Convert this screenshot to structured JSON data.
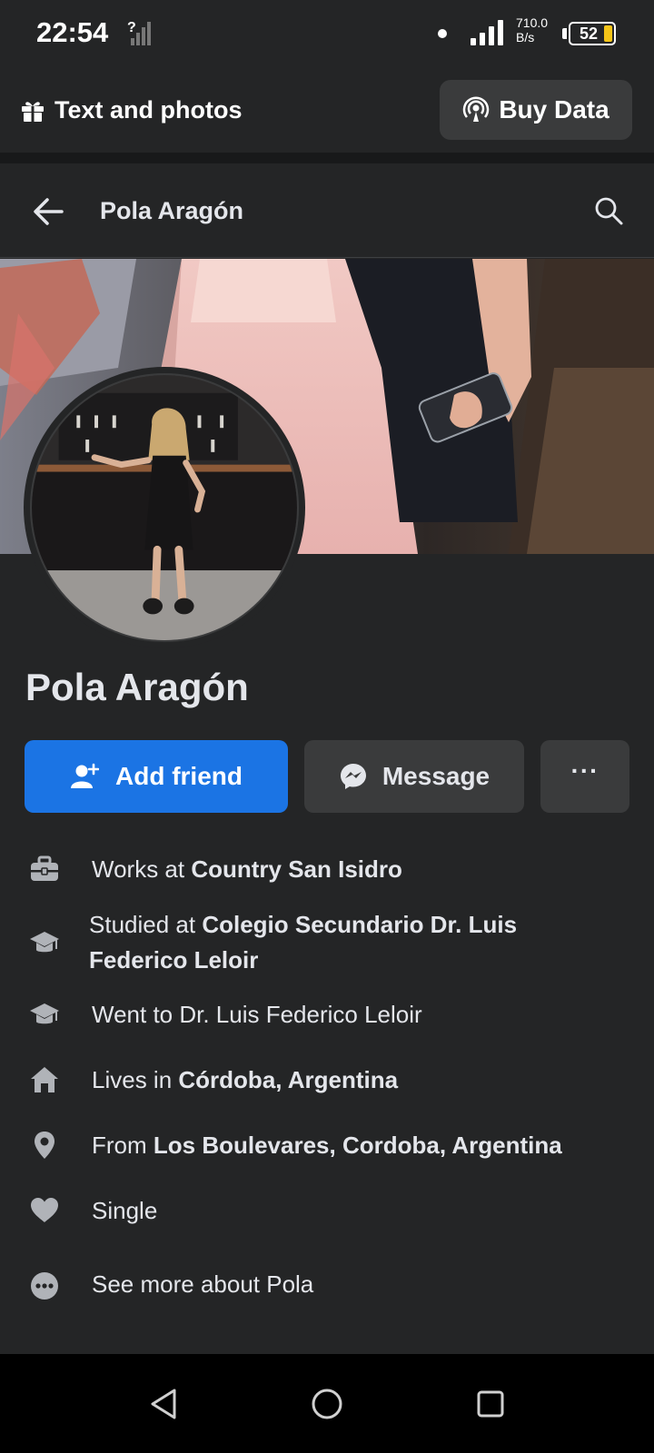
{
  "status": {
    "time": "22:54",
    "net_speed_value": "710.0",
    "net_speed_unit": "B/s",
    "battery_level": "52"
  },
  "promo": {
    "text_and_photos_label": "Text and photos",
    "buy_data_label": "Buy Data"
  },
  "nav": {
    "title": "Pola Aragón"
  },
  "profile": {
    "name": "Pola Aragón",
    "add_friend_label": "Add friend",
    "message_label": "Message",
    "more_label": "···"
  },
  "details": {
    "work_prefix": "Works at ",
    "work_value": "Country San Isidro",
    "study_prefix": "Studied at ",
    "study_value": "Colegio Secundario Dr. Luis Federico Leloir",
    "went_text": "Went to Dr. Luis Federico Leloir",
    "lives_prefix": "Lives in ",
    "lives_value": "Córdoba, Argentina",
    "from_prefix": "From ",
    "from_value": "Los Boulevares, Cordoba, Argentina",
    "relationship": "Single",
    "see_more": "See more about Pola"
  },
  "colors": {
    "primary_blue": "#1b74e4",
    "background": "#242526",
    "button_grey": "#3a3b3c",
    "text": "#e4e6eb",
    "battery_yellow": "#f5c518"
  },
  "icons": {
    "gift": "gift-icon",
    "buy_data": "broadcast-icon",
    "back": "back-arrow-icon",
    "search": "search-icon",
    "add_friend": "add-person-icon",
    "message": "messenger-icon",
    "work": "briefcase-icon",
    "study": "graduation-cap-icon",
    "went": "graduation-cap-icon",
    "lives": "home-icon",
    "from": "location-pin-icon",
    "relationship": "heart-icon",
    "see_more": "more-dots-icon"
  }
}
